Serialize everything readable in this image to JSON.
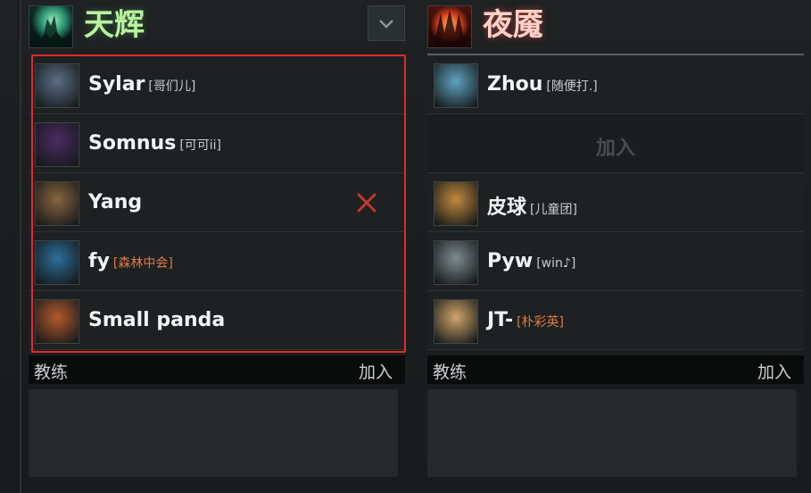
{
  "radiant": {
    "team_name": "天辉",
    "logo_icon": "radiant-team-logo",
    "players": [
      {
        "name": "Sylar",
        "tag": "[哥们儿]",
        "tag_color": "#c9cdcd",
        "avatar": "#5b6f86"
      },
      {
        "name": "Somnus",
        "tag": "[可可ii]",
        "tag_color": "#c9cdcd",
        "avatar": "#4b2b63"
      },
      {
        "name": "Yang",
        "tag": "",
        "tag_color": "#c9cdcd",
        "avatar": "#8a6440",
        "kick": true
      },
      {
        "name": "fy",
        "tag": "[森林中会]",
        "tag_color": "#e07a45",
        "avatar": "#2d6e9b"
      },
      {
        "name": "Small panda",
        "tag": "",
        "tag_color": "#c9cdcd",
        "avatar": "#b45a2c"
      }
    ],
    "coach_label": "教练",
    "coach_join": "加入"
  },
  "dire": {
    "team_name": "夜魇",
    "logo_icon": "dire-team-logo",
    "players": [
      {
        "name": "Zhou",
        "tag": "[随便打.]",
        "tag_color": "#c9cdcd",
        "avatar": "#5fa2bf",
        "empty": false
      },
      {
        "name": "",
        "tag": "",
        "join_label": "加入",
        "empty": true
      },
      {
        "name": "皮球",
        "tag": "[儿童团]",
        "tag_color": "#c9cdcd",
        "avatar": "#c18a3c",
        "empty": false
      },
      {
        "name": "Pyw",
        "tag": "[win♪]",
        "tag_color": "#c9cdcd",
        "avatar": "#7e8a90",
        "empty": false
      },
      {
        "name": "JT-",
        "tag": "[朴彩英]",
        "tag_color": "#e07a45",
        "avatar": "#d1a56b",
        "empty": false
      }
    ],
    "coach_label": "教练",
    "coach_join": "加入"
  },
  "colors": {
    "radiant_accent": "#b9f2a1",
    "dire_accent": "#ffd2c9",
    "selection_border": "#e1292c",
    "kick_icon": "#c0392b"
  },
  "icons": {
    "dropdown": "chevron-down-icon",
    "kick": "close-icon"
  }
}
